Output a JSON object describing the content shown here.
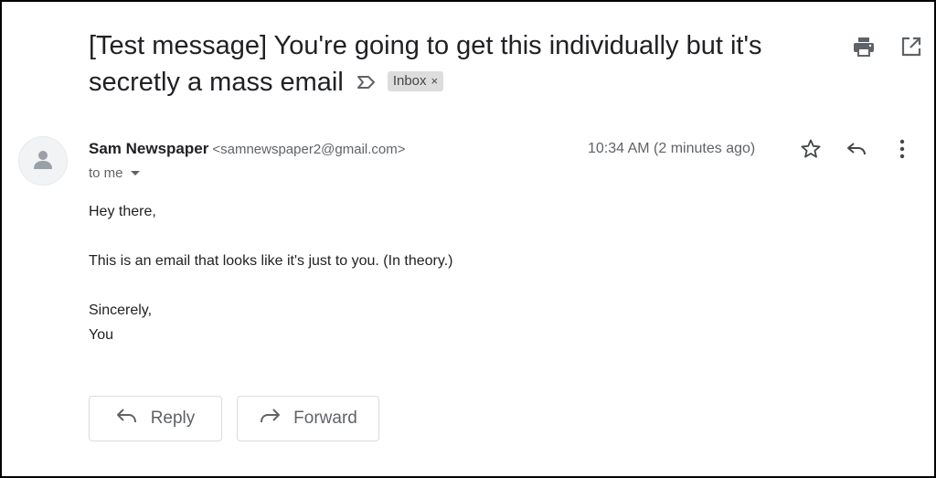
{
  "email": {
    "subject": "[Test message] You're going to get this individually but it's secretly a mass email",
    "label_chip": "Inbox",
    "label_chip_remove": "×",
    "sender": {
      "name": "Sam Newspaper",
      "email": "<samnewspaper2@gmail.com>",
      "recipient": "to me"
    },
    "timestamp": "10:34 AM (2 minutes ago)",
    "body": {
      "greeting": "Hey there,",
      "line1": "This is an email that looks like it's just to you. (In theory.)",
      "closing": "Sincerely,",
      "signature": "You"
    },
    "actions": {
      "reply_label": "Reply",
      "forward_label": "Forward"
    }
  },
  "icons": {
    "print": "print-icon",
    "open_new_window": "open-in-new-window-icon",
    "important_marker": "important-marker-icon",
    "star": "star-icon",
    "reply": "reply-icon",
    "more": "more-vertical-icon",
    "forward": "forward-icon",
    "avatar": "person-icon"
  },
  "colors": {
    "text_primary": "#202124",
    "text_secondary": "#5f6368",
    "chip_bg": "#dddddd",
    "border": "#dadce0"
  }
}
